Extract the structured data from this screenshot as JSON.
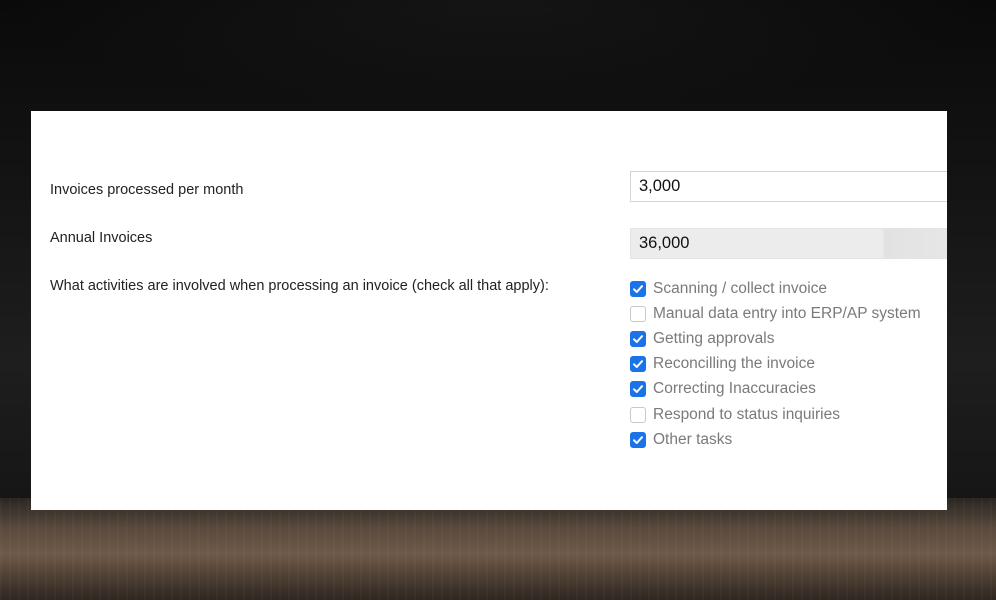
{
  "form": {
    "monthly": {
      "label": "Invoices processed per month",
      "value": "3,000"
    },
    "annual": {
      "label": "Annual Invoices",
      "value": "36,000"
    },
    "activities": {
      "question": "What activities are involved when processing an invoice (check all that apply):",
      "options": [
        {
          "label": "Scanning / collect invoice",
          "checked": true
        },
        {
          "label": "Manual data entry into ERP/AP system",
          "checked": false
        },
        {
          "label": "Getting approvals",
          "checked": true
        },
        {
          "label": "Reconcilling the invoice",
          "checked": true
        },
        {
          "label": "Correcting Inaccuracies",
          "checked": true
        },
        {
          "label": "Respond to status inquiries",
          "checked": false
        },
        {
          "label": "Other tasks",
          "checked": true
        }
      ]
    }
  },
  "colors": {
    "checkbox_accent": "#1a73e8",
    "label_text": "#222222",
    "option_text": "#7a7a7a",
    "readonly_field_bg": "#ececec"
  }
}
